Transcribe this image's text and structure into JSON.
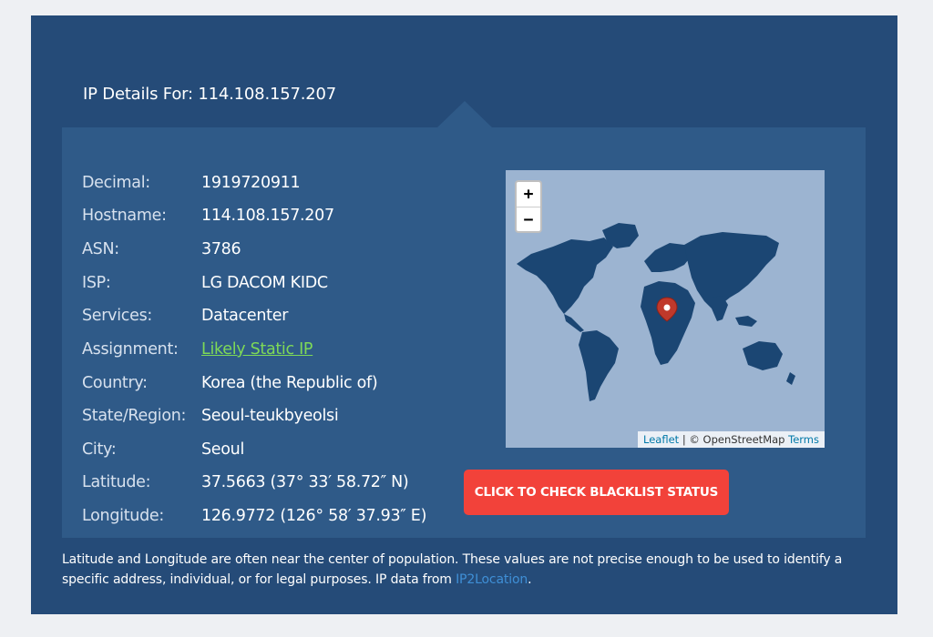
{
  "header": {
    "title": "IP Details For: 114.108.157.207"
  },
  "details": [
    {
      "label": "Decimal:",
      "value": "1919720911"
    },
    {
      "label": "Hostname:",
      "value": "114.108.157.207"
    },
    {
      "label": "ASN:",
      "value": "3786"
    },
    {
      "label": "ISP:",
      "value": "LG DACOM KIDC"
    },
    {
      "label": "Services:",
      "value": "Datacenter"
    },
    {
      "label": "Assignment:",
      "value": "Likely Static IP"
    },
    {
      "label": "Country:",
      "value": "Korea (the Republic of)"
    },
    {
      "label": "State/Region:",
      "value": "Seoul-teukbyeolsi"
    },
    {
      "label": "City:",
      "value": "Seoul"
    },
    {
      "label": "Latitude:",
      "value": "37.5663 (37° 33′ 58.72″ N)"
    },
    {
      "label": "Longitude:",
      "value": "126.9772 (126° 58′ 37.93″ E)"
    }
  ],
  "map": {
    "zoom_in": "+",
    "zoom_out": "−",
    "attribution_leaflet": "Leaflet",
    "attribution_sep": " | © OpenStreetMap ",
    "attribution_terms": "Terms",
    "marker_icon": "map-pin-icon",
    "ocean_color": "#9cb4d1",
    "land_color": "#1b4673",
    "marker_color": "#c0392b"
  },
  "blacklist_button": {
    "label": "CLICK TO CHECK BLACKLIST STATUS",
    "color": "#f2423a"
  },
  "footer": {
    "note": "Latitude and Longitude are often near the center of population. These values are not precise enough to be used to identify a specific address, individual, or for legal purposes. IP data from ",
    "source_link": "IP2Location",
    "end": "."
  }
}
